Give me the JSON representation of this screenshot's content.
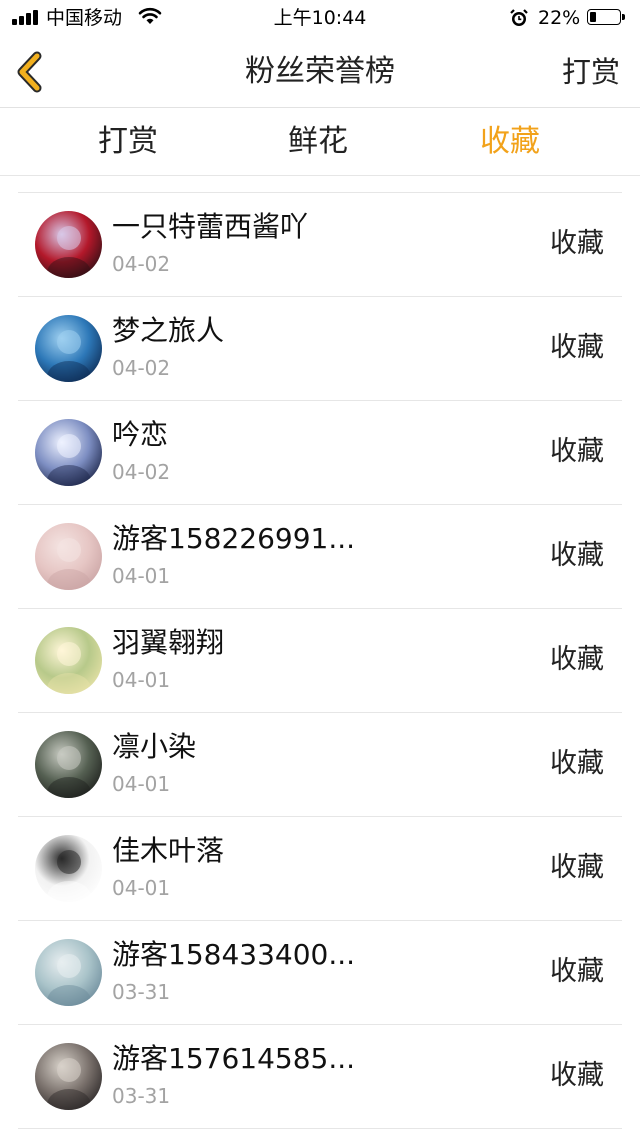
{
  "status_bar": {
    "carrier": "中国移动",
    "time": "上午10:44",
    "battery_percent_text": "22%",
    "battery_level": 0.22
  },
  "nav": {
    "back_icon": "chevron-left-icon",
    "back_color": "#f2b01e",
    "title": "粉丝荣誉榜",
    "right_label": "打赏"
  },
  "tabs": [
    {
      "label": "打赏",
      "active": false
    },
    {
      "label": "鲜花",
      "active": false
    },
    {
      "label": "收藏",
      "active": true
    }
  ],
  "colors": {
    "accent": "#f2a21a",
    "date_gray": "#a3a3a3",
    "divider": "#e6e6e6"
  },
  "fans": [
    {
      "name": "一只特蕾西酱吖",
      "date": "04-02",
      "type": "收藏"
    },
    {
      "name": "梦之旅人",
      "date": "04-02",
      "type": "收藏"
    },
    {
      "name": "吟恋",
      "date": "04-02",
      "type": "收藏"
    },
    {
      "name": "游客158226991...",
      "date": "04-01",
      "type": "收藏"
    },
    {
      "name": "羽翼翱翔",
      "date": "04-01",
      "type": "收藏"
    },
    {
      "name": "凛小染",
      "date": "04-01",
      "type": "收藏"
    },
    {
      "name": "佳木叶落",
      "date": "04-01",
      "type": "收藏"
    },
    {
      "name": "游客158433400...",
      "date": "03-31",
      "type": "收藏"
    },
    {
      "name": "游客157614585...",
      "date": "03-31",
      "type": "收藏"
    }
  ]
}
